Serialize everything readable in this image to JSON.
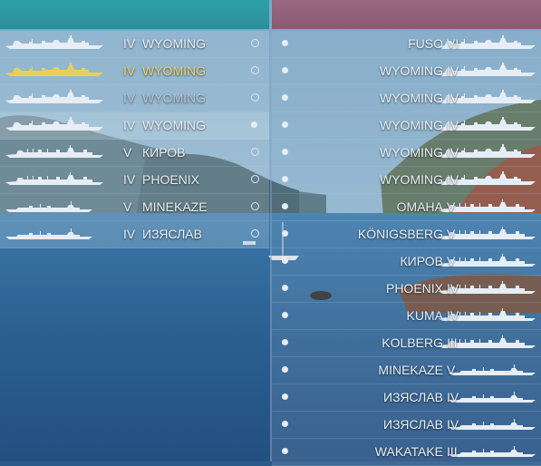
{
  "teams": {
    "left": {
      "color": "#2fa0a8",
      "rows": [
        {
          "tier": "IV",
          "name": "WYOMING",
          "ship_icon": "battleship-silhouette",
          "status": "ring",
          "highlight": "none"
        },
        {
          "tier": "IV",
          "name": "WYOMING",
          "ship_icon": "battleship-silhouette",
          "status": "ring",
          "highlight": "player"
        },
        {
          "tier": "IV",
          "name": "WYOMING",
          "ship_icon": "battleship-silhouette",
          "status": "ring",
          "highlight": "dead"
        },
        {
          "tier": "IV",
          "name": "WYOMING",
          "ship_icon": "battleship-silhouette",
          "status": "dot",
          "highlight": "selected"
        },
        {
          "tier": "V",
          "name": "КИРОВ",
          "ship_icon": "cruiser-silhouette",
          "status": "ring",
          "highlight": "none"
        },
        {
          "tier": "IV",
          "name": "PHOENIX",
          "ship_icon": "cruiser-silhouette",
          "status": "ring",
          "highlight": "none"
        },
        {
          "tier": "V",
          "name": "MINEKAZE",
          "ship_icon": "destroyer-silhouette",
          "status": "ring",
          "highlight": "none"
        },
        {
          "tier": "IV",
          "name": "ИЗЯСЛАВ",
          "ship_icon": "destroyer-silhouette",
          "status": "ring",
          "highlight": "none"
        }
      ]
    },
    "right": {
      "color": "#9a6780",
      "rows": [
        {
          "tier": "VI",
          "name": "FUSO",
          "ship_icon": "battleship-silhouette",
          "status": "dot"
        },
        {
          "tier": "IV",
          "name": "WYOMING",
          "ship_icon": "battleship-silhouette",
          "status": "dot"
        },
        {
          "tier": "IV",
          "name": "WYOMING",
          "ship_icon": "battleship-silhouette",
          "status": "dot"
        },
        {
          "tier": "IV",
          "name": "WYOMING",
          "ship_icon": "battleship-silhouette",
          "status": "dot"
        },
        {
          "tier": "IV",
          "name": "WYOMING",
          "ship_icon": "battleship-silhouette",
          "status": "dot"
        },
        {
          "tier": "IV",
          "name": "WYOMING",
          "ship_icon": "battleship-silhouette",
          "status": "dot"
        },
        {
          "tier": "V",
          "name": "OMAHA",
          "ship_icon": "cruiser-silhouette",
          "status": "dot"
        },
        {
          "tier": "V",
          "name": "KÖNIGSBERG",
          "ship_icon": "cruiser-silhouette",
          "status": "dot"
        },
        {
          "tier": "V",
          "name": "КИРОВ",
          "ship_icon": "cruiser-silhouette",
          "status": "dot"
        },
        {
          "tier": "IV",
          "name": "PHOENIX",
          "ship_icon": "cruiser-silhouette",
          "status": "dot"
        },
        {
          "tier": "IV",
          "name": "KUMA",
          "ship_icon": "cruiser-silhouette",
          "status": "dot"
        },
        {
          "tier": "III",
          "name": "KOLBERG",
          "ship_icon": "cruiser-silhouette",
          "status": "dot"
        },
        {
          "tier": "V",
          "name": "MINEKAZE",
          "ship_icon": "destroyer-silhouette",
          "status": "dot"
        },
        {
          "tier": "IV",
          "name": "ИЗЯСЛАВ",
          "ship_icon": "destroyer-silhouette",
          "status": "dot"
        },
        {
          "tier": "IV",
          "name": "ИЗЯСЛАВ",
          "ship_icon": "destroyer-silhouette",
          "status": "dot"
        },
        {
          "tier": "III",
          "name": "WAKATAKE",
          "ship_icon": "destroyer-silhouette",
          "status": "dot"
        }
      ]
    }
  },
  "colors": {
    "player": "#f0d060",
    "ship_silhouette": "#e6edf5",
    "player_silhouette": "#e8cf5a"
  }
}
